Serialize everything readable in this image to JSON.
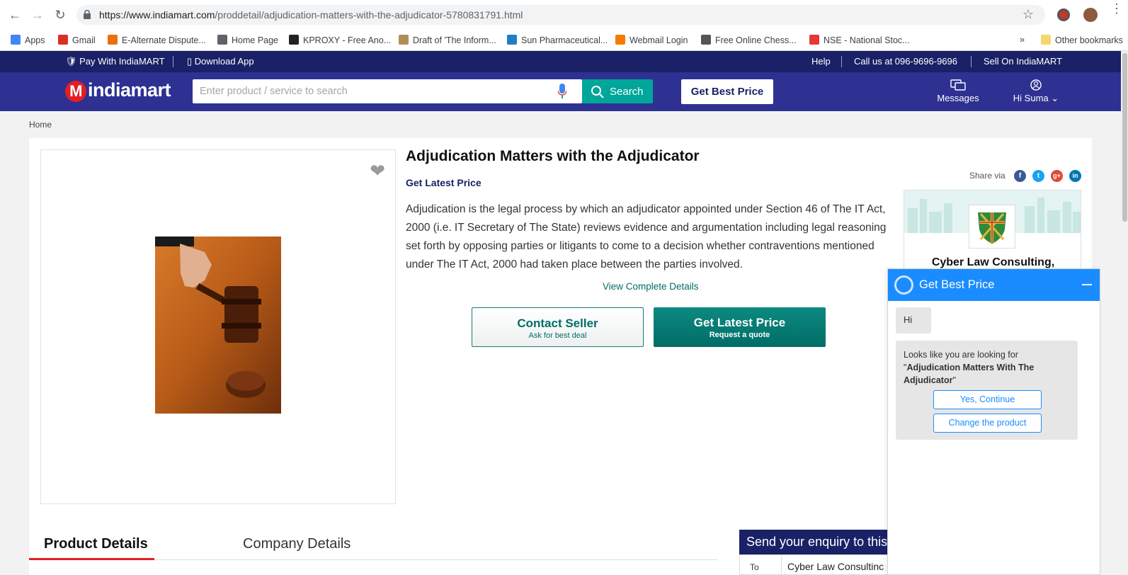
{
  "browser": {
    "url_domain": "https://www.indiamart.com",
    "url_path": "/proddetail/adjudication-matters-with-the-adjudicator-5780831791.html",
    "bookmarks": [
      {
        "label": "Apps",
        "color": "#4285f4"
      },
      {
        "label": "Gmail",
        "color": "#d93025"
      },
      {
        "label": "E-Alternate Dispute...",
        "color": "#e8710a"
      },
      {
        "label": "Home Page",
        "color": "#5f6368"
      },
      {
        "label": "KPROXY - Free Ano...",
        "color": "#222222"
      },
      {
        "label": "Draft of 'The Inform...",
        "color": "#b08d57"
      },
      {
        "label": "Sun Pharmaceutical...",
        "color": "#1f7fc4"
      },
      {
        "label": "Webmail Login",
        "color": "#f57c00"
      },
      {
        "label": "Free Online Chess...",
        "color": "#555555"
      },
      {
        "label": "NSE - National Stoc...",
        "color": "#e53935"
      }
    ],
    "overflow": "»",
    "other_bookmarks": "Other bookmarks"
  },
  "topstrip": {
    "pay": "Pay With IndiaMART",
    "download": "Download App",
    "help": "Help",
    "call": "Call us at 096-9696-9696",
    "sell": "Sell On IndiaMART"
  },
  "header": {
    "logo": "indiamart",
    "search_placeholder": "Enter product / service to search",
    "search_btn": "Search",
    "best_price_btn": "Get Best Price",
    "messages": "Messages",
    "user": "Hi Suma"
  },
  "breadcrumb": "Home",
  "product": {
    "title": "Adjudication Matters with the Adjudicator",
    "get_latest_price": "Get Latest Price",
    "description": "Adjudication is the legal process by which an adjudicator appointed under Section 46 of The IT Act, 2000 (i.e. IT Secretary of The State) reviews evidence and argumentation including legal reasoning set forth by opposing parties or litigants to come to a decision whether contraventions mentioned under The IT Act, 2000 had taken place between the parties involved.",
    "view_details": "View Complete Details",
    "contact_main": "Contact Seller",
    "contact_sub": "Ask for best deal",
    "quote_main": "Get Latest Price",
    "quote_sub": "Request a quote"
  },
  "share": {
    "label": "Share via",
    "networks": [
      "f",
      "t",
      "g+",
      "in"
    ]
  },
  "seller": {
    "name": "Cyber Law Consulting,"
  },
  "tabs": {
    "product": "Product Details",
    "company": "Company Details"
  },
  "enquiry": {
    "title": "Send your enquiry to this",
    "to_label": "To",
    "to_value": "Cyber Law Consultinc"
  },
  "chat": {
    "title": "Get Best Price",
    "greeting": "Hi",
    "msg_prefix": "Looks like you are looking for \"",
    "msg_product": "Adjudication Matters With The Adjudicator",
    "msg_suffix": "\"",
    "yes_btn": "Yes, Continue",
    "change_btn": "Change the product"
  }
}
